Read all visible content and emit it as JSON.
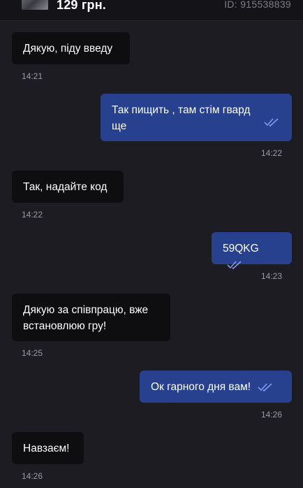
{
  "header": {
    "price": "129 грн.",
    "order_id": "ID: 915538839"
  },
  "colors": {
    "background": "#1c1c22",
    "incoming_bubble": "#0e0e11",
    "outgoing_bubble": "#27418f",
    "read_check": "#7f9cf0",
    "timestamp": "#9a9aa3"
  },
  "messages": [
    {
      "direction": "incoming",
      "text": "Дякую, піду введу",
      "time": "14:21"
    },
    {
      "direction": "outgoing",
      "text_line1": "Так пищить , там стім гвард",
      "text_line2": "ще",
      "time": "14:22",
      "status_icon": "double-check-icon"
    },
    {
      "direction": "incoming",
      "text": "Так, надайте код",
      "time": "14:22"
    },
    {
      "direction": "outgoing",
      "text": "59QKG",
      "time": "14:23",
      "status_icon": "double-check-icon"
    },
    {
      "direction": "incoming",
      "text_line1": "Дякую за співпрацю, вже",
      "text_line2": "встановлюю гру!",
      "time": "14:25"
    },
    {
      "direction": "outgoing",
      "text": "Ок гарного дня вам!",
      "time": "14:26",
      "status_icon": "double-check-icon"
    },
    {
      "direction": "incoming",
      "text": "Навзаєм!",
      "time": "14:26"
    }
  ]
}
